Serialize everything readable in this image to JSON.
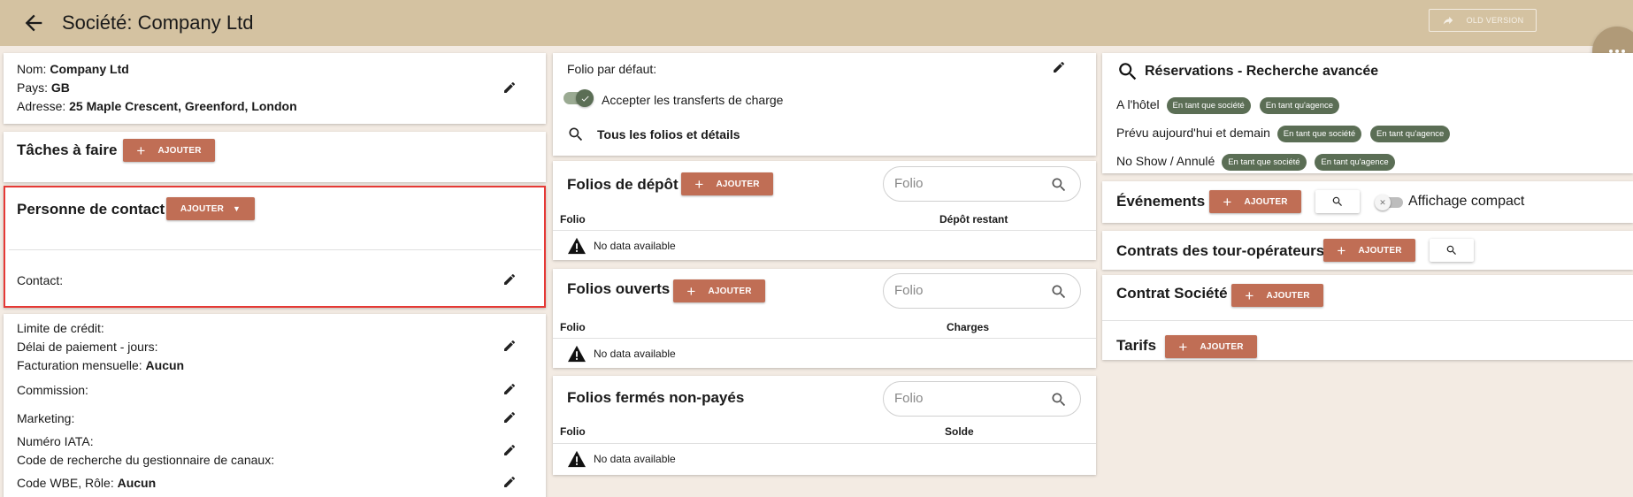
{
  "header": {
    "title": "Société: Company Ltd",
    "old_version": "OLD VERSION"
  },
  "company": {
    "name_label": "Nom:",
    "name": "Company Ltd",
    "country_label": "Pays:",
    "country": "GB",
    "address_label": "Adresse:",
    "address": "25 Maple Crescent, Greenford, London"
  },
  "tasks": {
    "title": "Tâches à faire",
    "add_label": "AJOUTER"
  },
  "contact": {
    "title": "Personne de contact",
    "add_label": "AJOUTER",
    "contact_label": "Contact:"
  },
  "billing": {
    "credit_limit": "Limite de crédit:",
    "payment_delay": "Délai de paiement - jours:",
    "monthly_billing_label": "Facturation mensuelle:",
    "monthly_billing": "Aucun",
    "commission": "Commission:",
    "marketing": "Marketing:",
    "iata": "Numéro IATA:",
    "channel_code": "Code de recherche du gestionnaire de canaux:",
    "wbe_label": "Code WBE, Rôle:",
    "wbe": "Aucun"
  },
  "folio_defaults": {
    "default_folio": "Folio par défaut:",
    "accept_transfers": "Accepter les transferts de charge",
    "accept_transfers_on": true,
    "all_folios": "Tous les folios et détails"
  },
  "deposit_folios": {
    "title": "Folios de dépôt",
    "add_label": "AJOUTER",
    "search_placeholder": "Folio",
    "columns": [
      "Folio",
      "Dépôt restant"
    ],
    "empty": "No data available"
  },
  "open_folios": {
    "title": "Folios ouverts",
    "add_label": "AJOUTER",
    "search_placeholder": "Folio",
    "columns": [
      "Folio",
      "Charges"
    ],
    "empty": "No data available"
  },
  "closed_unpaid_folios": {
    "title": "Folios fermés non-payés",
    "search_placeholder": "Folio",
    "columns": [
      "Folio",
      "Solde"
    ],
    "empty": "No data available"
  },
  "reservations": {
    "title": "Réservations - Recherche avancée",
    "rows": [
      {
        "label": "A l'hôtel",
        "chips": [
          "En tant que société",
          "En tant qu'agence"
        ]
      },
      {
        "label": "Prévu aujourd'hui et demain",
        "chips": [
          "En tant que société",
          "En tant qu'agence"
        ]
      },
      {
        "label": "No Show / Annulé",
        "chips": [
          "En tant que société",
          "En tant qu'agence"
        ]
      }
    ]
  },
  "events": {
    "title": "Événements",
    "add_label": "AJOUTER",
    "compact_label": "Affichage compact",
    "compact_on": false
  },
  "tour_contracts": {
    "title": "Contrats des tour-opérateurs",
    "add_label": "AJOUTER"
  },
  "company_contract": {
    "title": "Contrat Société",
    "add_label": "AJOUTER"
  },
  "rates": {
    "title": "Tarifs",
    "add_label": "AJOUTER"
  },
  "colors": {
    "header": "#d4c2a1",
    "accent": "#c06e55",
    "chip": "#5b6e55",
    "highlight": "#e53935"
  }
}
